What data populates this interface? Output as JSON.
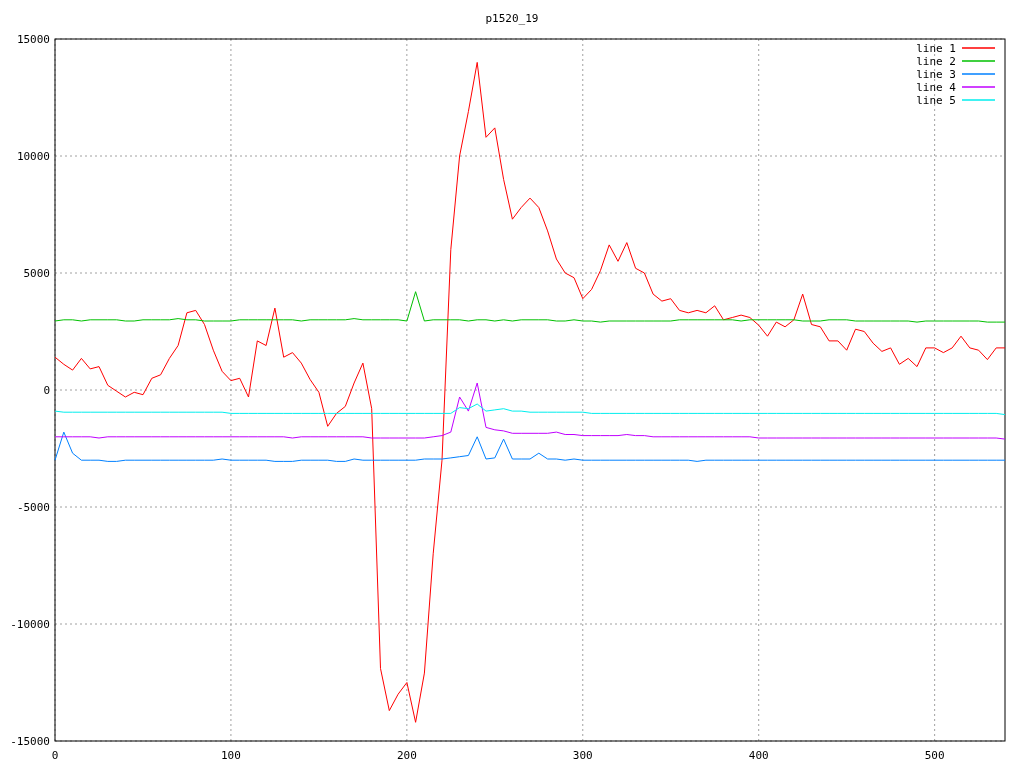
{
  "plot": {
    "chart_data": {
      "type": "line",
      "title": "p1520_19",
      "x": [
        0,
        5,
        10,
        15,
        20,
        25,
        30,
        35,
        40,
        45,
        50,
        55,
        60,
        65,
        70,
        75,
        80,
        85,
        90,
        95,
        100,
        105,
        110,
        115,
        120,
        125,
        130,
        135,
        140,
        145,
        150,
        155,
        160,
        165,
        170,
        175,
        180,
        185,
        190,
        195,
        200,
        205,
        210,
        215,
        220,
        225,
        230,
        235,
        240,
        245,
        250,
        255,
        260,
        265,
        270,
        275,
        280,
        285,
        290,
        295,
        300,
        305,
        310,
        315,
        320,
        325,
        330,
        335,
        340,
        345,
        350,
        355,
        360,
        365,
        370,
        375,
        380,
        385,
        390,
        395,
        400,
        405,
        410,
        415,
        420,
        425,
        430,
        435,
        440,
        445,
        450,
        455,
        460,
        465,
        470,
        475,
        480,
        485,
        490,
        495,
        500,
        505,
        510,
        515,
        520,
        525,
        530,
        535,
        540
      ],
      "series": [
        {
          "name": "line 1",
          "color": "#ff0000",
          "values": [
            1400,
            1100,
            850,
            1350,
            900,
            1000,
            200,
            -50,
            -300,
            -100,
            -200,
            500,
            650,
            1350,
            1900,
            3300,
            3400,
            2800,
            1700,
            800,
            400,
            500,
            -300,
            2100,
            1900,
            3500,
            1400,
            1600,
            1150,
            450,
            -100,
            -1550,
            -1000,
            -700,
            300,
            1150,
            -800,
            -11900,
            -13700,
            -13000,
            -12500,
            -14200,
            -12100,
            -7000,
            -3000,
            6000,
            10000,
            11900,
            14000,
            10800,
            11200,
            9000,
            7300,
            7800,
            8200,
            7800,
            6800,
            5600,
            5000,
            4800,
            3900,
            4300,
            5100,
            6200,
            5500,
            6300,
            5200,
            5000,
            4100,
            3800,
            3900,
            3400,
            3300,
            3400,
            3300,
            3600,
            3000,
            3100,
            3200,
            3100,
            2770,
            2300,
            2900,
            2700,
            3000,
            4100,
            2800,
            2700,
            2100,
            2100,
            1700,
            2600,
            2500,
            2000,
            1650,
            1800,
            1100,
            1350,
            1000,
            1800,
            1800,
            1600,
            1800,
            2300,
            1800,
            1700,
            1300,
            1800,
            1800
          ]
        },
        {
          "name": "line 2",
          "color": "#00c000",
          "values": [
            2950,
            3000,
            3000,
            2950,
            3000,
            3000,
            3000,
            3000,
            2950,
            2950,
            3000,
            3000,
            3000,
            3000,
            3050,
            3000,
            3000,
            2950,
            2950,
            2950,
            2950,
            3000,
            3000,
            3000,
            3000,
            3000,
            3000,
            3000,
            2950,
            3000,
            3000,
            3000,
            3000,
            3000,
            3050,
            3000,
            3000,
            3000,
            3000,
            3000,
            2950,
            4200,
            2950,
            3000,
            3000,
            3000,
            3000,
            2950,
            3000,
            3000,
            2950,
            3000,
            2950,
            3000,
            3000,
            3000,
            3000,
            2950,
            2950,
            3000,
            2950,
            2950,
            2900,
            2950,
            2950,
            2950,
            2950,
            2950,
            2950,
            2950,
            2950,
            3000,
            3000,
            3000,
            3000,
            3000,
            3000,
            3000,
            2950,
            3000,
            3000,
            3000,
            3000,
            3000,
            3000,
            2950,
            2950,
            2950,
            3000,
            3000,
            3000,
            2950,
            2950,
            2950,
            2950,
            2950,
            2950,
            2950,
            2900,
            2950,
            2950,
            2950,
            2950,
            2950,
            2950,
            2950,
            2900,
            2900,
            2900
          ]
        },
        {
          "name": "line 3",
          "color": "#0080ff",
          "values": [
            -3000,
            -1800,
            -2700,
            -3000,
            -3000,
            -3000,
            -3050,
            -3050,
            -3000,
            -3000,
            -3000,
            -3000,
            -3000,
            -3000,
            -3000,
            -3000,
            -3000,
            -3000,
            -3000,
            -2950,
            -3000,
            -3000,
            -3000,
            -3000,
            -3000,
            -3050,
            -3050,
            -3050,
            -3000,
            -3000,
            -3000,
            -3000,
            -3050,
            -3050,
            -2950,
            -3000,
            -3000,
            -3000,
            -3000,
            -3000,
            -3000,
            -3000,
            -2950,
            -2950,
            -2950,
            -2900,
            -2850,
            -2800,
            -2000,
            -2950,
            -2900,
            -2100,
            -2950,
            -2950,
            -2950,
            -2700,
            -2950,
            -2950,
            -3000,
            -2950,
            -3000,
            -3000,
            -3000,
            -3000,
            -3000,
            -3000,
            -3000,
            -3000,
            -3000,
            -3000,
            -3000,
            -3000,
            -3000,
            -3050,
            -3000,
            -3000,
            -3000,
            -3000,
            -3000,
            -3000,
            -3000,
            -3000,
            -3000,
            -3000,
            -3000,
            -3000,
            -3000,
            -3000,
            -3000,
            -3000,
            -3000,
            -3000,
            -3000,
            -3000,
            -3000,
            -3000,
            -3000,
            -3000,
            -3000,
            -3000,
            -3000,
            -3000,
            -3000,
            -3000,
            -3000,
            -3000,
            -3000,
            -3000,
            -3000
          ]
        },
        {
          "name": "line 4",
          "color": "#c000ff",
          "values": [
            -2000,
            -2000,
            -2000,
            -2000,
            -2000,
            -2050,
            -2000,
            -2000,
            -2000,
            -2000,
            -2000,
            -2000,
            -2000,
            -2000,
            -2000,
            -2000,
            -2000,
            -2000,
            -2000,
            -2000,
            -2000,
            -2000,
            -2000,
            -2000,
            -2000,
            -2000,
            -2000,
            -2050,
            -2000,
            -2000,
            -2000,
            -2000,
            -2000,
            -2000,
            -2000,
            -2000,
            -2050,
            -2050,
            -2050,
            -2050,
            -2050,
            -2050,
            -2050,
            -2000,
            -1950,
            -1800,
            -300,
            -900,
            300,
            -1600,
            -1700,
            -1750,
            -1850,
            -1850,
            -1850,
            -1850,
            -1850,
            -1800,
            -1900,
            -1900,
            -1950,
            -1950,
            -1950,
            -1950,
            -1950,
            -1900,
            -1950,
            -1950,
            -2000,
            -2000,
            -2000,
            -2000,
            -2000,
            -2000,
            -2000,
            -2000,
            -2000,
            -2000,
            -2000,
            -2000,
            -2050,
            -2050,
            -2050,
            -2050,
            -2050,
            -2050,
            -2050,
            -2050,
            -2050,
            -2050,
            -2050,
            -2050,
            -2050,
            -2050,
            -2050,
            -2050,
            -2050,
            -2050,
            -2050,
            -2050,
            -2050,
            -2050,
            -2050,
            -2050,
            -2050,
            -2050,
            -2050,
            -2050,
            -2100
          ]
        },
        {
          "name": "line 5",
          "color": "#00eeee",
          "values": [
            -900,
            -950,
            -950,
            -950,
            -950,
            -950,
            -950,
            -950,
            -950,
            -950,
            -950,
            -950,
            -950,
            -950,
            -950,
            -950,
            -950,
            -950,
            -950,
            -950,
            -1000,
            -1000,
            -1000,
            -1000,
            -1000,
            -1000,
            -1000,
            -1000,
            -1000,
            -1000,
            -1000,
            -1000,
            -1000,
            -1000,
            -1000,
            -1000,
            -1000,
            -1000,
            -1000,
            -1000,
            -1000,
            -1000,
            -1000,
            -1000,
            -1000,
            -1000,
            -750,
            -800,
            -600,
            -900,
            -850,
            -800,
            -900,
            -900,
            -950,
            -950,
            -950,
            -950,
            -950,
            -950,
            -950,
            -1000,
            -1000,
            -1000,
            -1000,
            -1000,
            -1000,
            -1000,
            -1000,
            -1000,
            -1000,
            -1000,
            -1000,
            -1000,
            -1000,
            -1000,
            -1000,
            -1000,
            -1000,
            -1000,
            -1000,
            -1000,
            -1000,
            -1000,
            -1000,
            -1000,
            -1000,
            -1000,
            -1000,
            -1000,
            -1000,
            -1000,
            -1000,
            -1000,
            -1000,
            -1000,
            -1000,
            -1000,
            -1000,
            -1000,
            -1000,
            -1000,
            -1000,
            -1000,
            -1000,
            -1000,
            -1000,
            -1000,
            -1050
          ]
        }
      ],
      "xlim": [
        0,
        540
      ],
      "ylim": [
        -15000,
        15000
      ],
      "xticks": [
        0,
        100,
        200,
        300,
        400,
        500
      ],
      "yticks": [
        -15000,
        -10000,
        -5000,
        0,
        5000,
        10000,
        15000
      ],
      "grid": true,
      "legend": true
    }
  }
}
